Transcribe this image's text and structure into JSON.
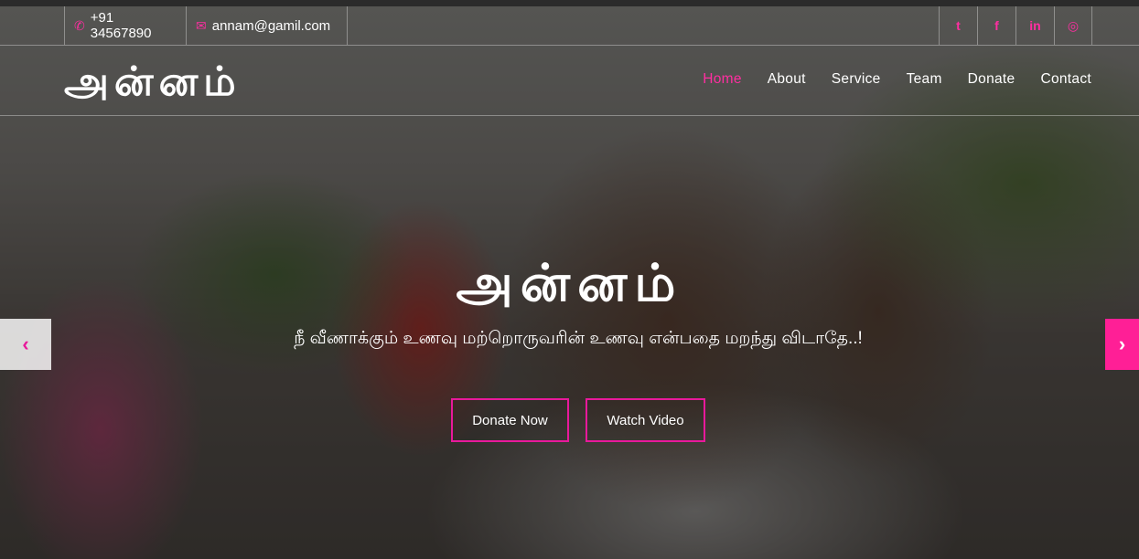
{
  "topbar": {
    "phone": "+91 34567890",
    "email": "annam@gamil.com",
    "socials": [
      {
        "icon": "twitter-icon",
        "glyph": "t"
      },
      {
        "icon": "facebook-icon",
        "glyph": "f"
      },
      {
        "icon": "linkedin-icon",
        "glyph": "in"
      },
      {
        "icon": "instagram-icon",
        "glyph": "◎"
      }
    ]
  },
  "nav": {
    "brand": "அன்னம்",
    "links": [
      "Home",
      "About",
      "Service",
      "Team",
      "Donate",
      "Contact"
    ],
    "active": "Home"
  },
  "hero": {
    "title": "அன்னம்",
    "subtitle": "நீ வீணாக்கும் உணவு மற்றொருவரின் உணவு என்பதை மறந்து விடாதே..!",
    "donate_label": "Donate Now",
    "watch_label": "Watch Video",
    "prev_arrow": "‹",
    "next_arrow": "›"
  },
  "colors": {
    "accent": "#ff2ea1"
  }
}
